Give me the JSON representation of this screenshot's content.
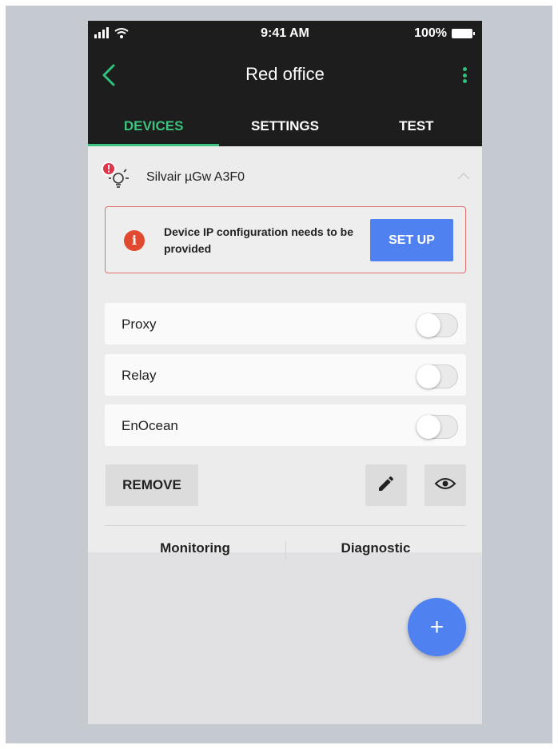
{
  "status_bar": {
    "time": "9:41 AM",
    "battery": "100%"
  },
  "header": {
    "title": "Red office"
  },
  "tabs": [
    {
      "label": "DEVICES",
      "active": true
    },
    {
      "label": "SETTINGS",
      "active": false
    },
    {
      "label": "TEST",
      "active": false
    }
  ],
  "device": {
    "name": "Silvair µGw  A3F0"
  },
  "alert": {
    "message": "Device IP configuration needs to be provided",
    "action_label": "SET UP",
    "icon": "info-icon"
  },
  "toggles": [
    {
      "label": "Proxy",
      "enabled": false
    },
    {
      "label": "Relay",
      "enabled": false
    },
    {
      "label": "EnOcean",
      "enabled": false
    }
  ],
  "actions": {
    "remove_label": "REMOVE",
    "edit_icon": "pencil-icon",
    "view_icon": "eye-icon"
  },
  "bottom_tabs": [
    {
      "label": "Monitoring"
    },
    {
      "label": "Diagnostic"
    }
  ],
  "fab": {
    "label": "+"
  },
  "colors": {
    "accent_green": "#3cc37d",
    "primary_blue": "#4f81f1",
    "alert_red": "#e04a2f",
    "topbar": "#1d1d1d"
  }
}
